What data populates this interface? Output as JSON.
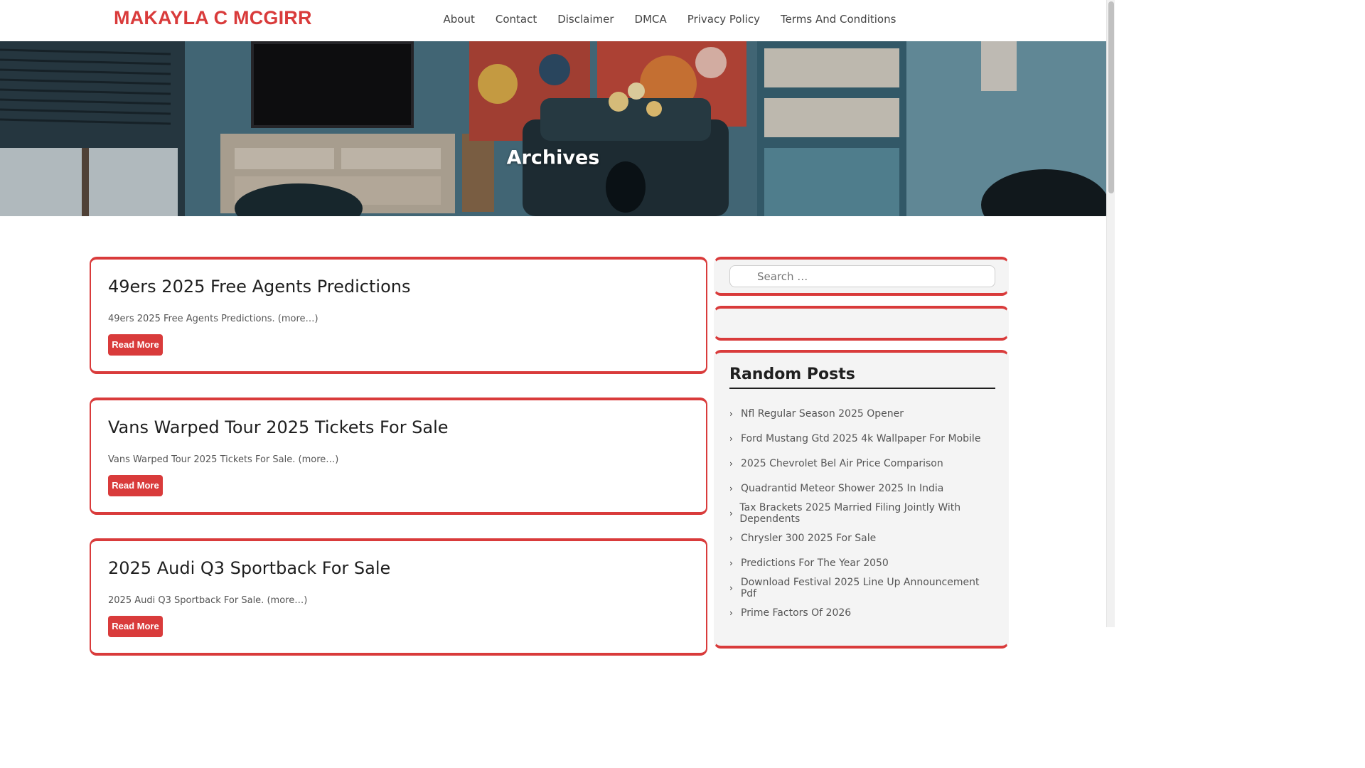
{
  "site": {
    "brand": "MAKAYLA C MCGIRR"
  },
  "nav": [
    "About",
    "Contact",
    "Disclaimer",
    "DMCA",
    "Privacy Policy",
    "Terms And Conditions"
  ],
  "hero": {
    "title": "Archives"
  },
  "posts": [
    {
      "title": "49ers 2025 Free Agents Predictions",
      "excerpt": "49ers 2025 Free Agents Predictions.",
      "more": "(more…)",
      "button": "Read More"
    },
    {
      "title": "Vans Warped Tour 2025 Tickets For Sale",
      "excerpt": "Vans Warped Tour 2025 Tickets For Sale.",
      "more": "(more…)",
      "button": "Read More"
    },
    {
      "title": "2025 Audi Q3 Sportback For Sale",
      "excerpt": "2025 Audi Q3 Sportback For Sale.",
      "more": "(more…)",
      "button": "Read More"
    }
  ],
  "sidebar": {
    "search": {
      "placeholder": "Search …"
    },
    "random_posts": {
      "title": "Random Posts",
      "items": [
        "Nfl Regular Season 2025 Opener",
        "Ford Mustang Gtd 2025 4k Wallpaper For Mobile",
        "2025 Chevrolet Bel Air Price Comparison",
        "Quadrantid Meteor Shower 2025 In India",
        "Tax Brackets 2025 Married Filing Jointly With Dependents",
        "Chrysler 300 2025 For Sale",
        "Predictions For The Year 2050",
        "Download Festival 2025 Line Up Announcement Pdf",
        "Prime Factors Of 2026"
      ]
    }
  },
  "colors": {
    "accent": "#d93b3b",
    "text": "#222222",
    "sidebar_bg": "#f4f4f4"
  }
}
